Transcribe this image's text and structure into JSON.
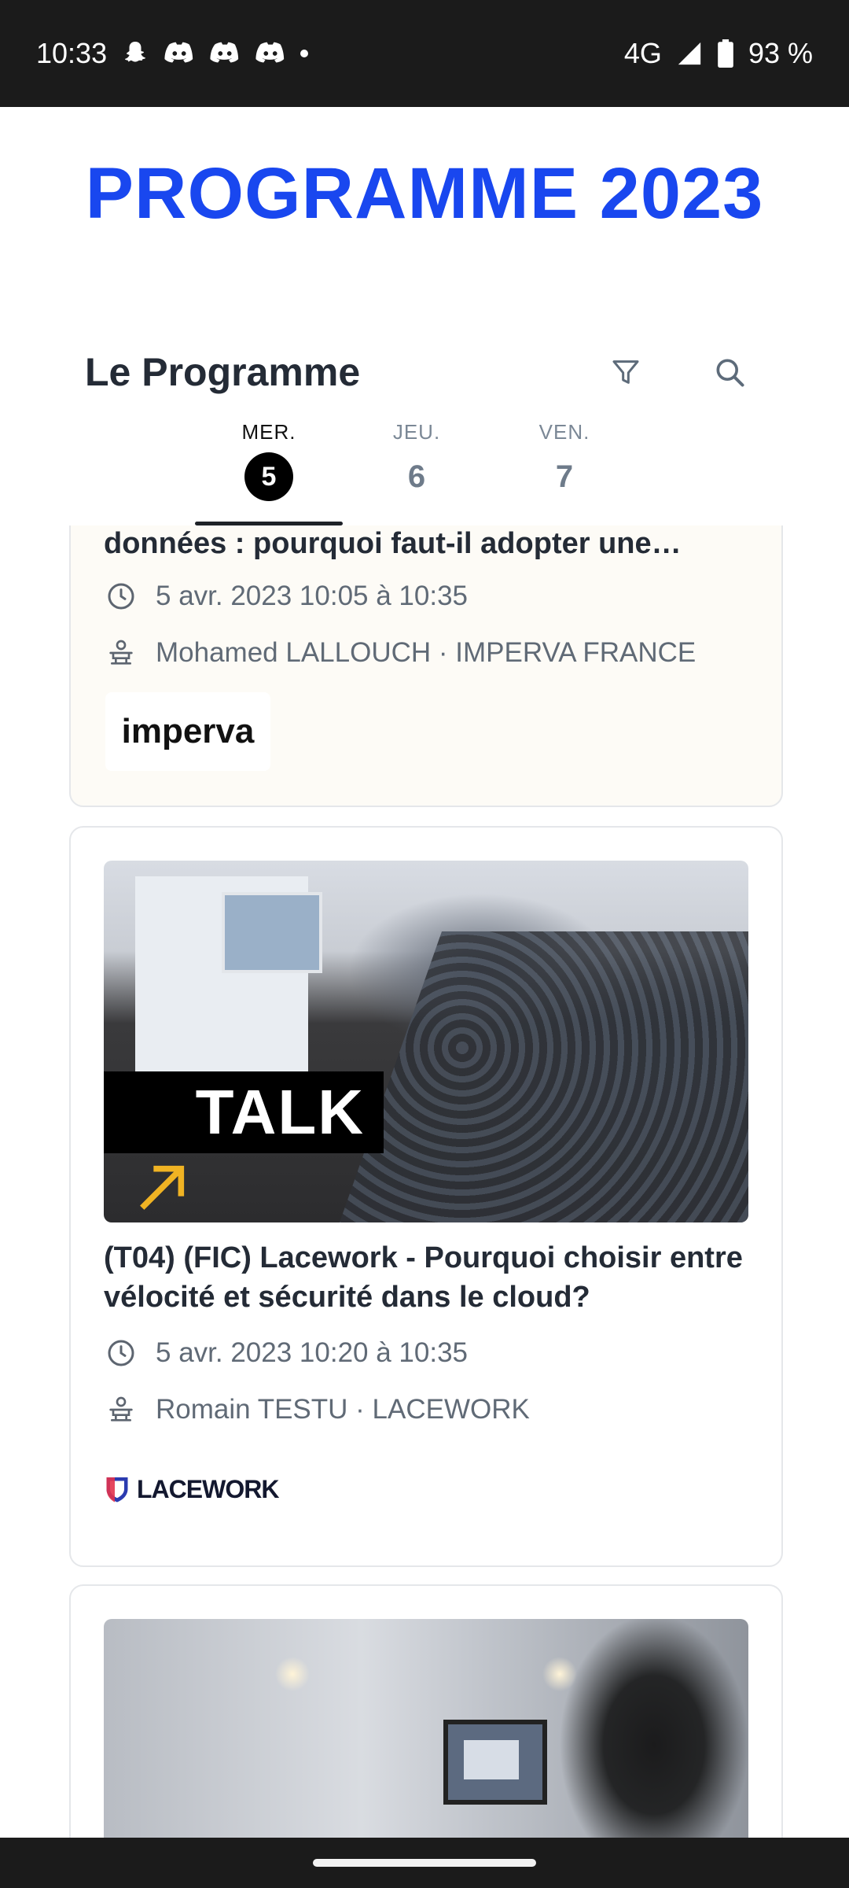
{
  "status_bar": {
    "time": "10:33",
    "network": "4G",
    "battery": "93 %"
  },
  "hero": {
    "title": "PROGRAMME 2023"
  },
  "toolbar": {
    "title": "Le Programme"
  },
  "days": [
    {
      "label": "MER.",
      "num": "5"
    },
    {
      "label": "JEU.",
      "num": "6"
    },
    {
      "label": "VEN.",
      "num": "7"
    }
  ],
  "cards": [
    {
      "title": "données : pourquoi faut-il adopter une…",
      "time": "5 avr. 2023 10:05 à 10:35",
      "speaker": "Mohamed LALLOUCH · IMPERVA FRANCE",
      "logo": "imperva"
    },
    {
      "image_label": "TALK",
      "title": "(T04) (FIC) Lacework - Pourquoi choisir entre vélocité et sécurité dans le cloud?",
      "time": "5 avr. 2023 10:20 à 10:35",
      "speaker": "Romain TESTU · LACEWORK",
      "logo": "LACEWORK"
    }
  ],
  "icons": {
    "filter": "filter-icon",
    "search": "search-icon",
    "clock": "clock-icon",
    "speaker": "speaker-icon"
  },
  "colors": {
    "accent": "#1947ef",
    "card_highlight": "#fdfbf6"
  }
}
